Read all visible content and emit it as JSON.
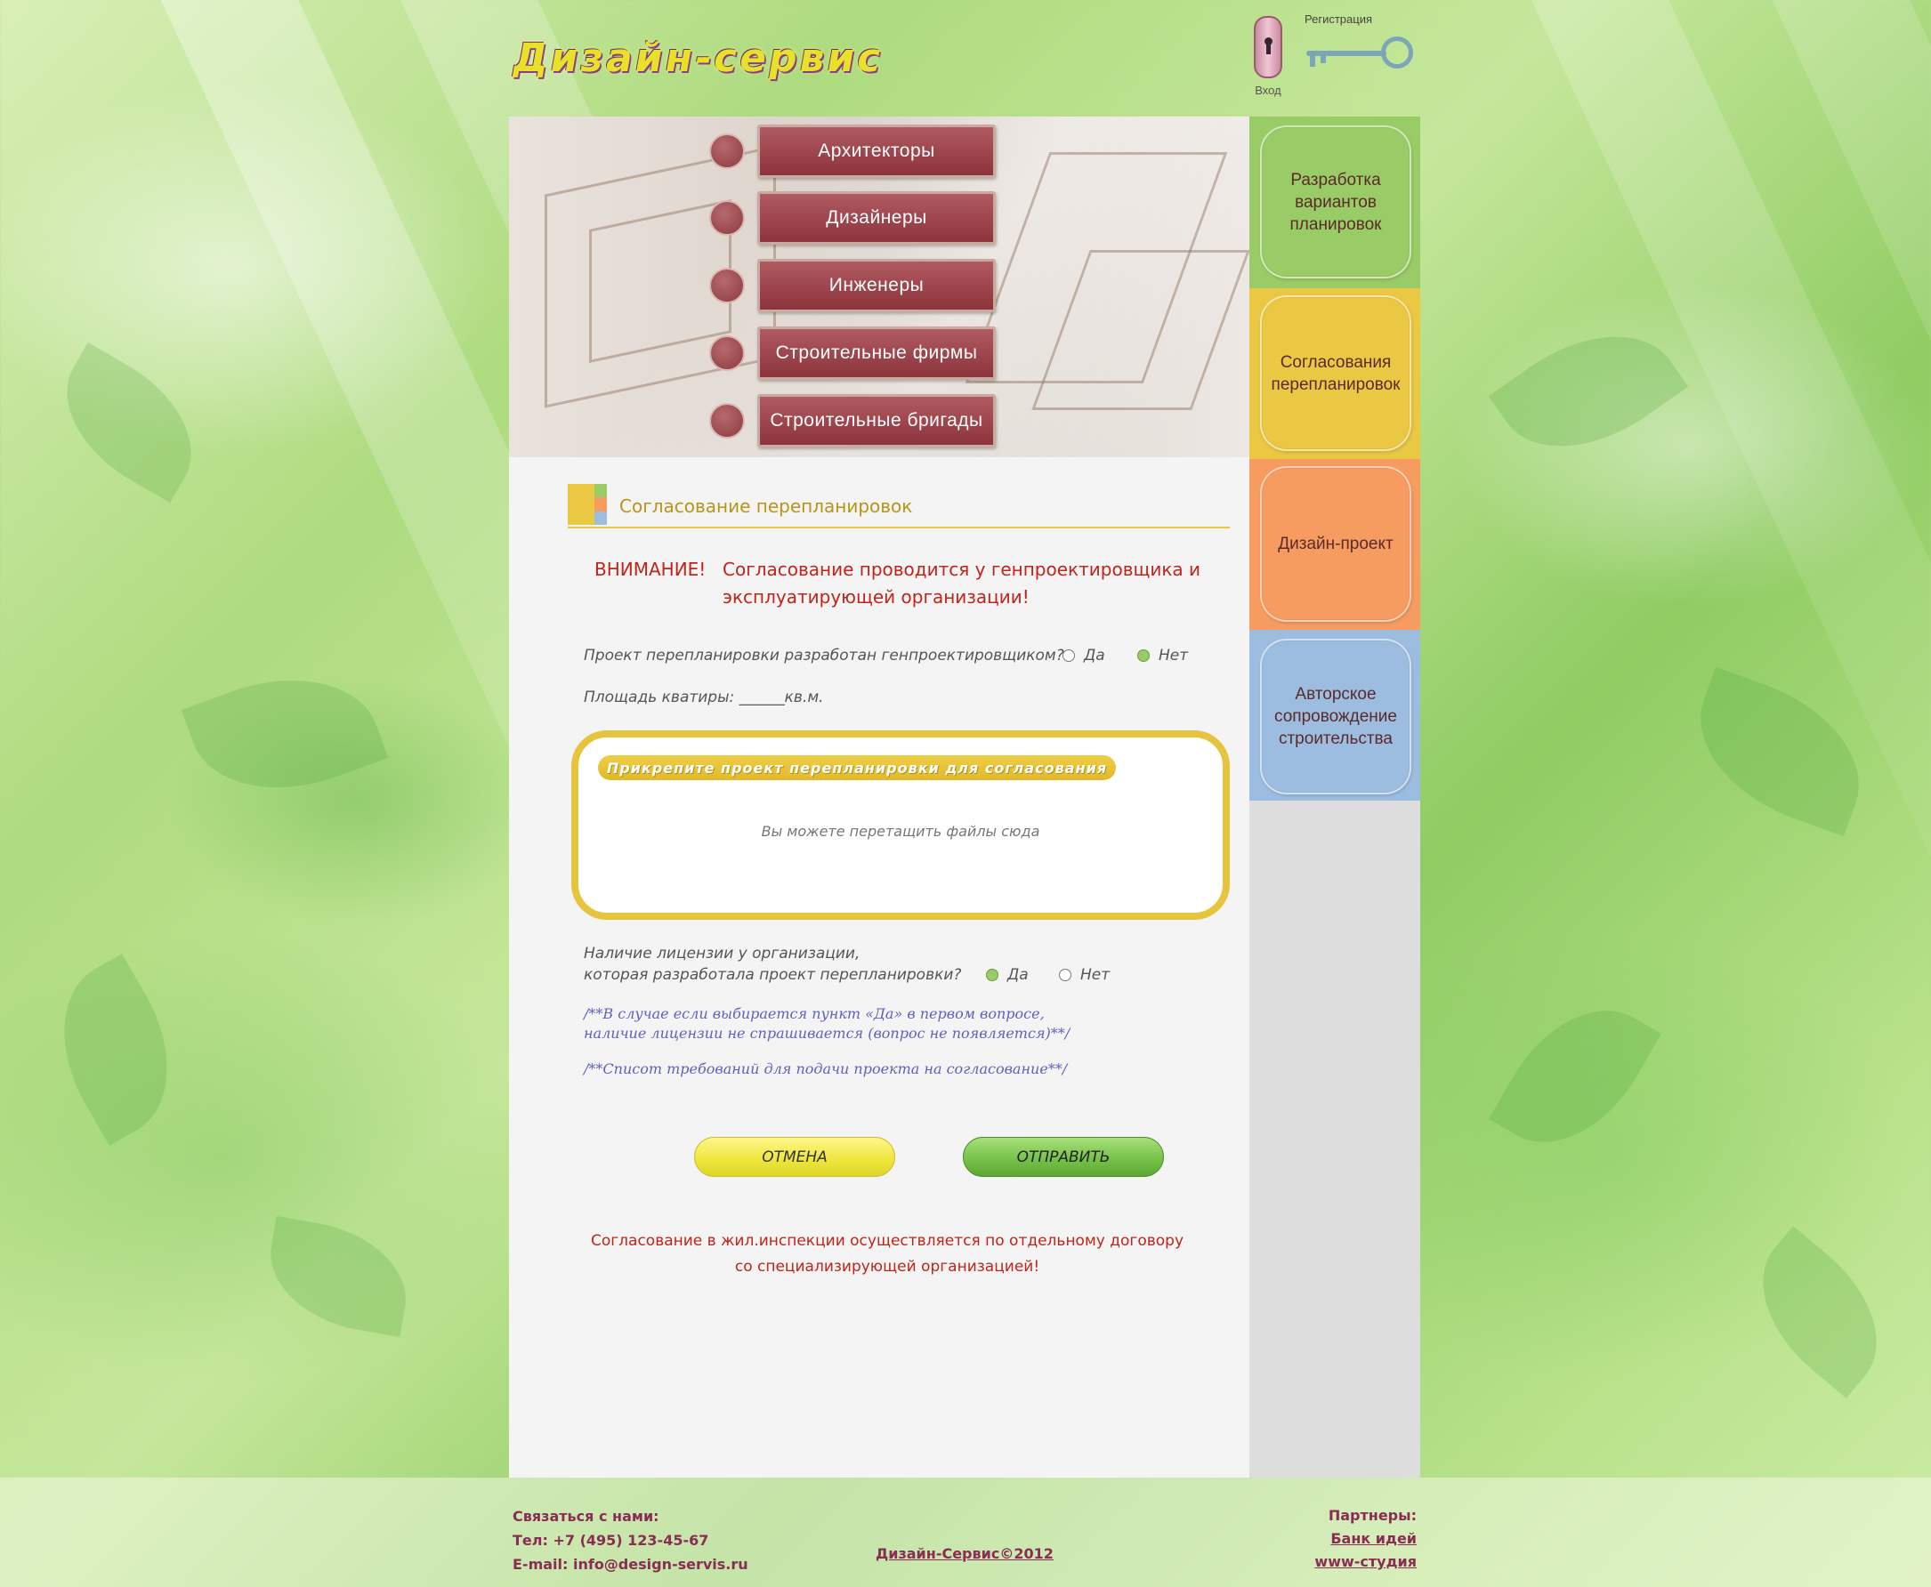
{
  "header": {
    "logo_text": "Дизайн-сервис",
    "login_label": "Вход",
    "register_label": "Регистрация"
  },
  "menu": {
    "items": [
      {
        "label": "Архитекторы"
      },
      {
        "label": "Дизайнеры"
      },
      {
        "label": "Инженеры"
      },
      {
        "label": "Строительные фирмы"
      },
      {
        "label": "Строительные бригады"
      }
    ]
  },
  "sidebar": {
    "items": [
      {
        "label": "Разработка вариантов планировок",
        "color": "#99cc66"
      },
      {
        "label": "Согласования перепланировок",
        "color": "#eac844"
      },
      {
        "label": "Дизайн-проект",
        "color": "#f79c60"
      },
      {
        "label": "Авторское сопровождение строительства",
        "color": "#9dbde0"
      }
    ]
  },
  "section": {
    "title": "Согласование перепланировок"
  },
  "warning": {
    "label": "ВНИМАНИЕ!",
    "text": "Согласование проводится у генпроектировщика и эксплуатирующей организации!"
  },
  "form": {
    "q_general_designer": "Проект перепланировки разработан генпроектировщиком?",
    "opt_yes": "Да",
    "opt_no": "Нет",
    "q1_selected": "Нет",
    "area_label": "Площадь кватиры: ______кв.м.",
    "dropzone_title": "Прикрепите проект перепланировки для согласования",
    "dropzone_hint": "Вы можете перетащить файлы сюда",
    "q_license_line1": "Наличие лицензии у организации,",
    "q_license_line2": "которая разработала проект перепланировки?",
    "q2_selected": "Да",
    "note1_line1": "/**В случае если выбирается пункт «Да» в первом вопросе,",
    "note1_line2": "наличие лицензии не спрашивается (вопрос не появляется)**/",
    "note2": "/**Списот требований для подачи проекта на согласование**/",
    "cancel_label": "ОТМЕНА",
    "submit_label": "ОТПРАВИТЬ"
  },
  "bottom_note": {
    "line1": "Согласование в жил.инспекции осуществляется по отдельному договору",
    "line2": "со специализирующей организацией!"
  },
  "footer": {
    "contact_heading": "Связаться с нами:",
    "phone": "Тел: +7 (495) 123-45-67",
    "email": "E-mail: info@design-servis.ru",
    "copyright": "Дизайн-Сервис©2012",
    "partners_heading": "Партнеры:",
    "partner1": "Банк идей",
    "partner2": "www-студия"
  }
}
